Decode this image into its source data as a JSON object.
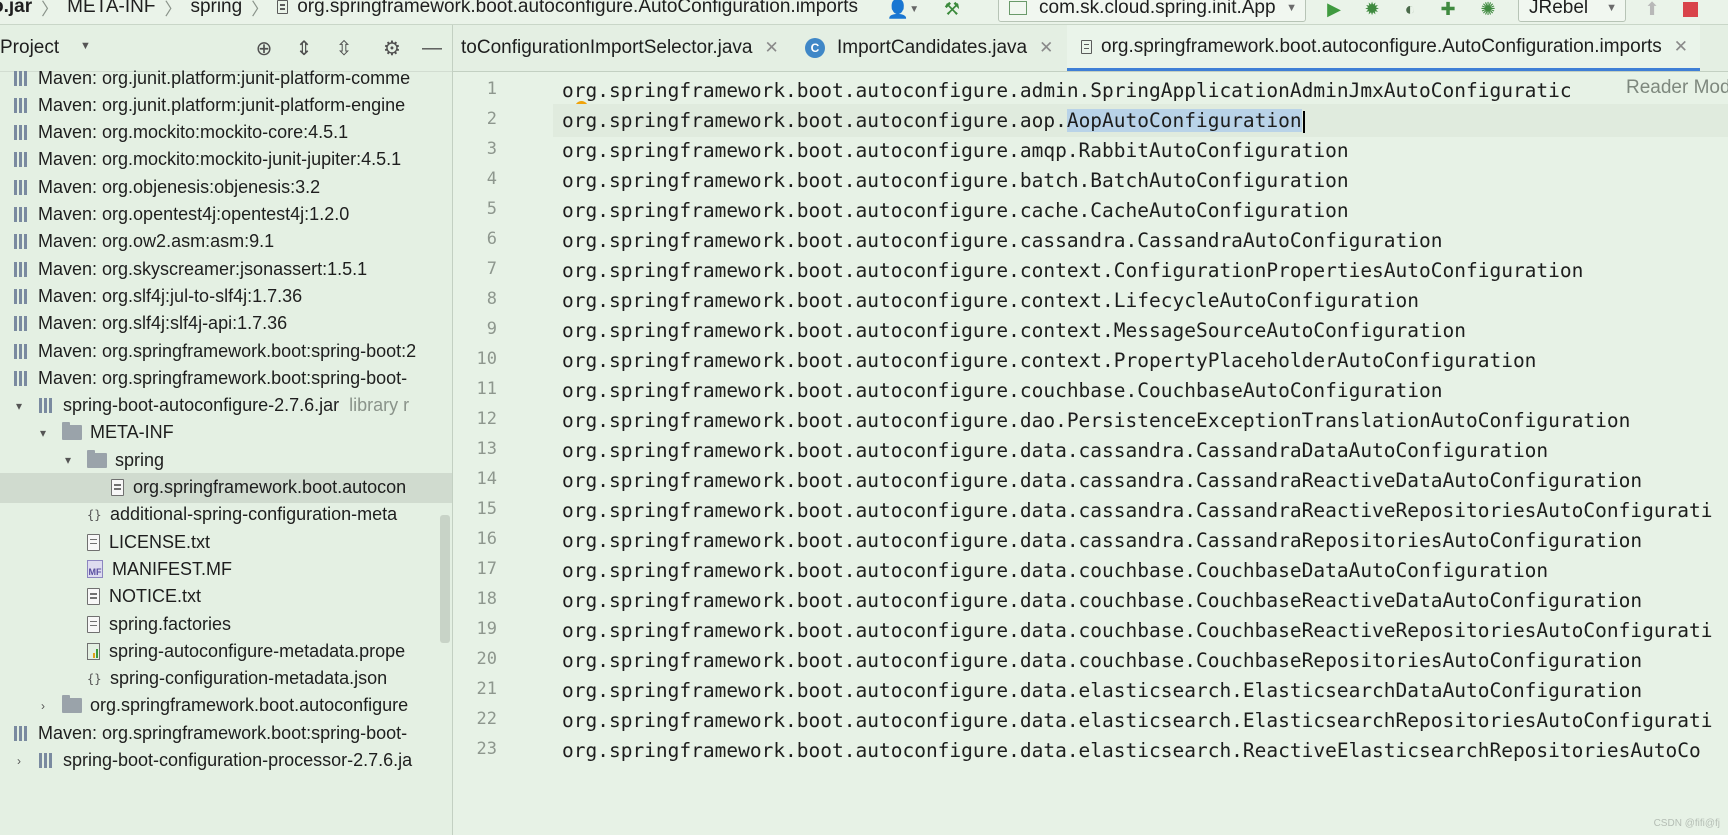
{
  "breadcrumb": {
    "items": [
      "o.jar",
      "META-INF",
      "spring"
    ],
    "file": "org.springframework.boot.autoconfigure.AutoConfiguration.imports"
  },
  "toolbar": {
    "run_config": "com.sk.cloud.spring.init.App",
    "jrebel": "JRebel"
  },
  "project": {
    "title": "Project",
    "tree": [
      {
        "label": "Maven: org.junit.platform:junit-platform-comme",
        "type": "lib",
        "indent": 0
      },
      {
        "label": "Maven: org.junit.platform:junit-platform-engine",
        "type": "lib",
        "indent": 0
      },
      {
        "label": "Maven: org.mockito:mockito-core:4.5.1",
        "type": "lib",
        "indent": 0
      },
      {
        "label": "Maven: org.mockito:mockito-junit-jupiter:4.5.1",
        "type": "lib",
        "indent": 0
      },
      {
        "label": "Maven: org.objenesis:objenesis:3.2",
        "type": "lib",
        "indent": 0
      },
      {
        "label": "Maven: org.opentest4j:opentest4j:1.2.0",
        "type": "lib",
        "indent": 0
      },
      {
        "label": "Maven: org.ow2.asm:asm:9.1",
        "type": "lib",
        "indent": 0
      },
      {
        "label": "Maven: org.skyscreamer:jsonassert:1.5.1",
        "type": "lib",
        "indent": 0
      },
      {
        "label": "Maven: org.slf4j:jul-to-slf4j:1.7.36",
        "type": "lib",
        "indent": 0
      },
      {
        "label": "Maven: org.slf4j:slf4j-api:1.7.36",
        "type": "lib",
        "indent": 0
      },
      {
        "label": "Maven: org.springframework.boot:spring-boot:2",
        "type": "lib",
        "indent": 0
      },
      {
        "label": "Maven: org.springframework.boot:spring-boot-",
        "type": "lib",
        "indent": 0
      },
      {
        "label": "spring-boot-autoconfigure-2.7.6.jar",
        "suffix": "library r",
        "type": "jar",
        "indent": 1,
        "twisty": "▾"
      },
      {
        "label": "META-INF",
        "type": "folder",
        "indent": 2,
        "twisty": "▾"
      },
      {
        "label": "spring",
        "type": "folder",
        "indent": 3,
        "twisty": "▾"
      },
      {
        "label": "org.springframework.boot.autocon",
        "type": "file",
        "indent": 4,
        "selected": true
      },
      {
        "label": "additional-spring-configuration-meta",
        "type": "json",
        "indent": 3
      },
      {
        "label": "LICENSE.txt",
        "type": "file",
        "indent": 3
      },
      {
        "label": "MANIFEST.MF",
        "type": "mf",
        "indent": 3
      },
      {
        "label": "NOTICE.txt",
        "type": "file",
        "indent": 3
      },
      {
        "label": "spring.factories",
        "type": "file",
        "indent": 3
      },
      {
        "label": "spring-autoconfigure-metadata.prope",
        "type": "props",
        "indent": 3
      },
      {
        "label": "spring-configuration-metadata.json",
        "type": "json",
        "indent": 3
      },
      {
        "label": "org.springframework.boot.autoconfigure",
        "type": "folder",
        "indent": 2,
        "twisty": "›"
      },
      {
        "label": "Maven: org.springframework.boot:spring-boot-",
        "type": "lib",
        "indent": 0
      },
      {
        "label": "spring-boot-configuration-processor-2.7.6.ja",
        "type": "jar",
        "indent": 1,
        "twisty": "›"
      }
    ]
  },
  "tabs": [
    {
      "label": "toConfigurationImportSelector.java",
      "icon": "none",
      "active": false
    },
    {
      "label": "ImportCandidates.java",
      "icon": "class-icon",
      "active": false
    },
    {
      "label": "org.springframework.boot.autoconfigure.AutoConfiguration.imports",
      "icon": "file-icon",
      "active": true
    }
  ],
  "editor": {
    "reader_mode": "Reader Mod",
    "watermark": "CSDN @fifi@fj",
    "selected_token": "AopAutoConfiguration",
    "lines": [
      {
        "n": "1",
        "text": "org.springframework.boot.autoconfigure.admin.SpringApplicationAdminJmxAutoConfiguratic"
      },
      {
        "n": "2",
        "text": "org.springframework.boot.autoconfigure.aop.",
        "selected": "AopAutoConfiguration"
      },
      {
        "n": "3",
        "text": "org.springframework.boot.autoconfigure.amqp.RabbitAutoConfiguration"
      },
      {
        "n": "4",
        "text": "org.springframework.boot.autoconfigure.batch.BatchAutoConfiguration"
      },
      {
        "n": "5",
        "text": "org.springframework.boot.autoconfigure.cache.CacheAutoConfiguration"
      },
      {
        "n": "6",
        "text": "org.springframework.boot.autoconfigure.cassandra.CassandraAutoConfiguration"
      },
      {
        "n": "7",
        "text": "org.springframework.boot.autoconfigure.context.ConfigurationPropertiesAutoConfiguration"
      },
      {
        "n": "8",
        "text": "org.springframework.boot.autoconfigure.context.LifecycleAutoConfiguration"
      },
      {
        "n": "9",
        "text": "org.springframework.boot.autoconfigure.context.MessageSourceAutoConfiguration"
      },
      {
        "n": "10",
        "text": "org.springframework.boot.autoconfigure.context.PropertyPlaceholderAutoConfiguration"
      },
      {
        "n": "11",
        "text": "org.springframework.boot.autoconfigure.couchbase.CouchbaseAutoConfiguration"
      },
      {
        "n": "12",
        "text": "org.springframework.boot.autoconfigure.dao.PersistenceExceptionTranslationAutoConfiguration"
      },
      {
        "n": "13",
        "text": "org.springframework.boot.autoconfigure.data.cassandra.CassandraDataAutoConfiguration"
      },
      {
        "n": "14",
        "text": "org.springframework.boot.autoconfigure.data.cassandra.CassandraReactiveDataAutoConfiguration"
      },
      {
        "n": "15",
        "text": "org.springframework.boot.autoconfigure.data.cassandra.CassandraReactiveRepositoriesAutoConfigurati"
      },
      {
        "n": "16",
        "text": "org.springframework.boot.autoconfigure.data.cassandra.CassandraRepositoriesAutoConfiguration"
      },
      {
        "n": "17",
        "text": "org.springframework.boot.autoconfigure.data.couchbase.CouchbaseDataAutoConfiguration"
      },
      {
        "n": "18",
        "text": "org.springframework.boot.autoconfigure.data.couchbase.CouchbaseReactiveDataAutoConfiguration"
      },
      {
        "n": "19",
        "text": "org.springframework.boot.autoconfigure.data.couchbase.CouchbaseReactiveRepositoriesAutoConfigurati"
      },
      {
        "n": "20",
        "text": "org.springframework.boot.autoconfigure.data.couchbase.CouchbaseRepositoriesAutoConfiguration"
      },
      {
        "n": "21",
        "text": "org.springframework.boot.autoconfigure.data.elasticsearch.ElasticsearchDataAutoConfiguration"
      },
      {
        "n": "22",
        "text": "org.springframework.boot.autoconfigure.data.elasticsearch.ElasticsearchRepositoriesAutoConfigurati"
      },
      {
        "n": "23",
        "text": "org.springframework.boot.autoconfigure.data.elasticsearch.ReactiveElasticsearchRepositoriesAutoCo"
      }
    ]
  }
}
